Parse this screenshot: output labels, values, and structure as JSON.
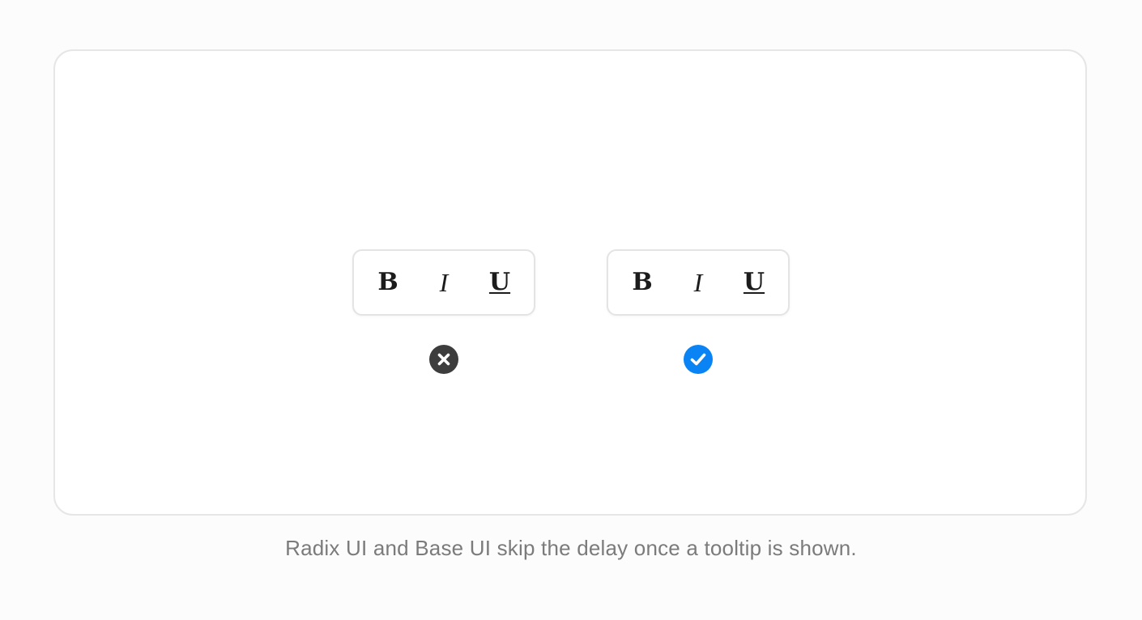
{
  "toolbars": {
    "left": {
      "bold": "B",
      "italic": "I",
      "underline": "U"
    },
    "right": {
      "bold": "B",
      "italic": "I",
      "underline": "U"
    }
  },
  "status": {
    "left": {
      "icon": "close-circle-icon",
      "color": "#3d3d3d"
    },
    "right": {
      "icon": "check-circle-icon",
      "color": "#0a84f5"
    }
  },
  "caption": "Radix UI and Base UI skip the delay once a tooltip is shown."
}
